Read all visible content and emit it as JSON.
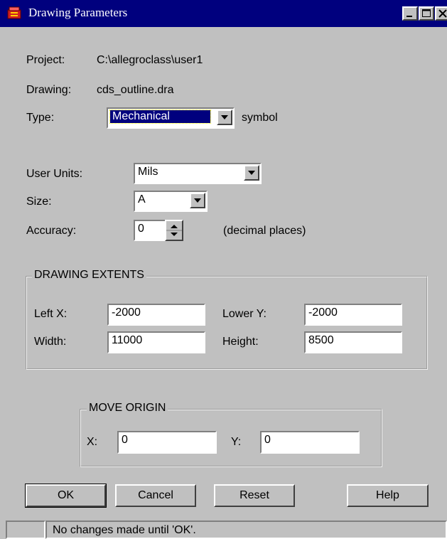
{
  "window": {
    "title": "Drawing Parameters"
  },
  "info": {
    "project_label": "Project:",
    "project_value": "C:\\allegroclass\\user1",
    "drawing_label": "Drawing:",
    "drawing_value": "cds_outline.dra",
    "type_label": "Type:",
    "type_value": "Mechanical",
    "type_suffix": "symbol"
  },
  "units": {
    "user_units_label": "User Units:",
    "user_units_value": "Mils",
    "size_label": "Size:",
    "size_value": "A",
    "accuracy_label": "Accuracy:",
    "accuracy_value": "0",
    "accuracy_suffix": "(decimal places)"
  },
  "extents": {
    "title": "DRAWING EXTENTS",
    "left_x_label": "Left X:",
    "left_x_value": "-2000",
    "lower_y_label": "Lower Y:",
    "lower_y_value": "-2000",
    "width_label": "Width:",
    "width_value": "11000",
    "height_label": "Height:",
    "height_value": "8500"
  },
  "origin": {
    "title": "MOVE ORIGIN",
    "x_label": "X:",
    "x_value": "0",
    "y_label": "Y:",
    "y_value": "0"
  },
  "buttons": {
    "ok": "OK",
    "cancel": "Cancel",
    "reset": "Reset",
    "help": "Help"
  },
  "status": {
    "message": "No changes made until 'OK'."
  },
  "colors": {
    "titlebar": "#00007e",
    "face": "#c0c0c0",
    "selection": "#00007e"
  },
  "icons": {
    "app": "app-icon",
    "minimize": "minimize-icon",
    "maximize": "maximize-icon",
    "close": "close-icon",
    "dropdown": "chevron-down-icon",
    "spin": "spin-arrows-icon"
  }
}
